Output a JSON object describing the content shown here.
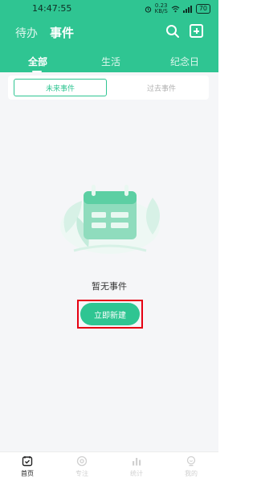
{
  "status_bar": {
    "time": "14:47:55",
    "network_speed_top": "0.23",
    "network_speed_bottom": "KB/S",
    "battery": "70"
  },
  "header": {
    "nav_todo": "待办",
    "nav_events": "事件",
    "search_icon": "search-icon",
    "add_icon": "add-square-icon"
  },
  "category_tabs": [
    {
      "label": "全部",
      "selected": true
    },
    {
      "label": "生活",
      "selected": false
    },
    {
      "label": "纪念日",
      "selected": false
    }
  ],
  "segment": {
    "future_label": "未来事件",
    "past_label": "过去事件",
    "selected": "future"
  },
  "empty_state": {
    "illustration_icon": "calendar-leaves-illustration",
    "message": "暂无事件",
    "create_button_label": "立即新建"
  },
  "bottom_nav": [
    {
      "label": "首页",
      "icon": "home-icon",
      "active": true
    },
    {
      "label": "专注",
      "icon": "focus-icon",
      "active": false
    },
    {
      "label": "统计",
      "icon": "stats-icon",
      "active": false
    },
    {
      "label": "我的",
      "icon": "profile-icon",
      "active": false
    }
  ],
  "colors": {
    "accent": "#2fc592",
    "background": "#f5f6f8",
    "highlight_outline": "#e60012",
    "inactive_text": "#b0b0b0"
  }
}
